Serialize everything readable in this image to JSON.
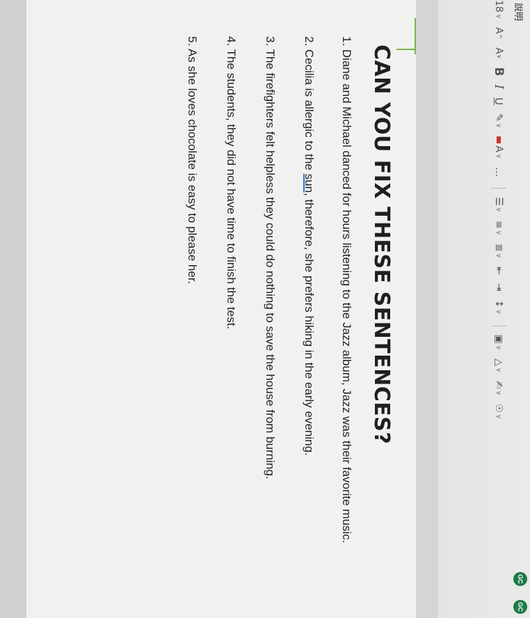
{
  "toolbar": {
    "menu": [
      "說明"
    ],
    "font_size": "18",
    "increase_font": "A",
    "decrease_font": "A",
    "bold": "B",
    "italic": "I",
    "underline": "U",
    "more": "…",
    "badge": "GC"
  },
  "document": {
    "title": "CAN YOU FIX THESE SENTENCES?",
    "sentences": [
      "1. Diane and Michael danced for hours listening to the Jazz album, Jazz was their favorite music.",
      "2. Cecilia is allergic to the ",
      "sun,",
      " therefore, she prefers hiking in the early evening.",
      "3. The firefighters felt helpless they could do nothing to save the house from burning.",
      "4. The students,  they did not have time to finish the test.",
      "5. As she loves chocolate is easy to please her."
    ]
  },
  "colors": {
    "accent": "#7bb34a",
    "spellcheck": "#3a6fd8",
    "badge": "#1e7a46"
  }
}
